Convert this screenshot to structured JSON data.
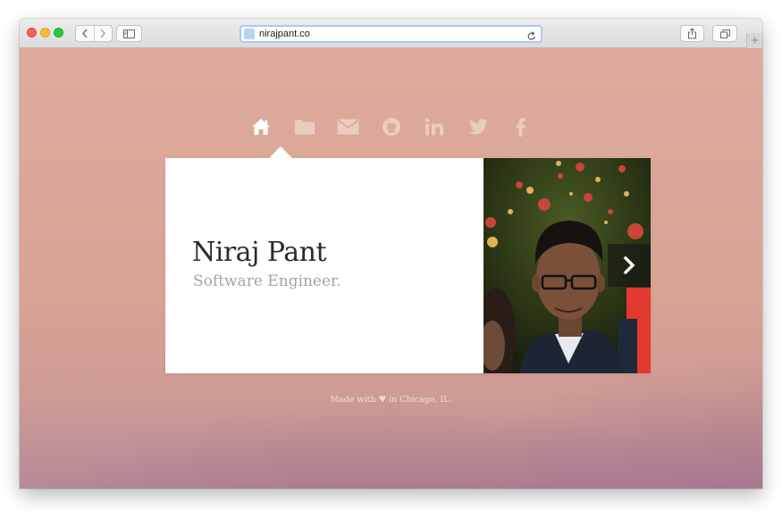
{
  "browser": {
    "url": "nirajpant.co",
    "new_tab_glyph": "+"
  },
  "social_icons": [
    "home-icon",
    "folder-icon",
    "envelope-icon",
    "github-icon",
    "linkedin-icon",
    "twitter-icon",
    "facebook-icon"
  ],
  "profile": {
    "name": "Niraj Pant",
    "title": "Software Engineer."
  },
  "footer": {
    "text": "Made with ♥ in Chicago, IL."
  },
  "colors": {
    "background": "#deab9c",
    "icon": "#eecbc0",
    "active_icon": "#ffffff"
  }
}
